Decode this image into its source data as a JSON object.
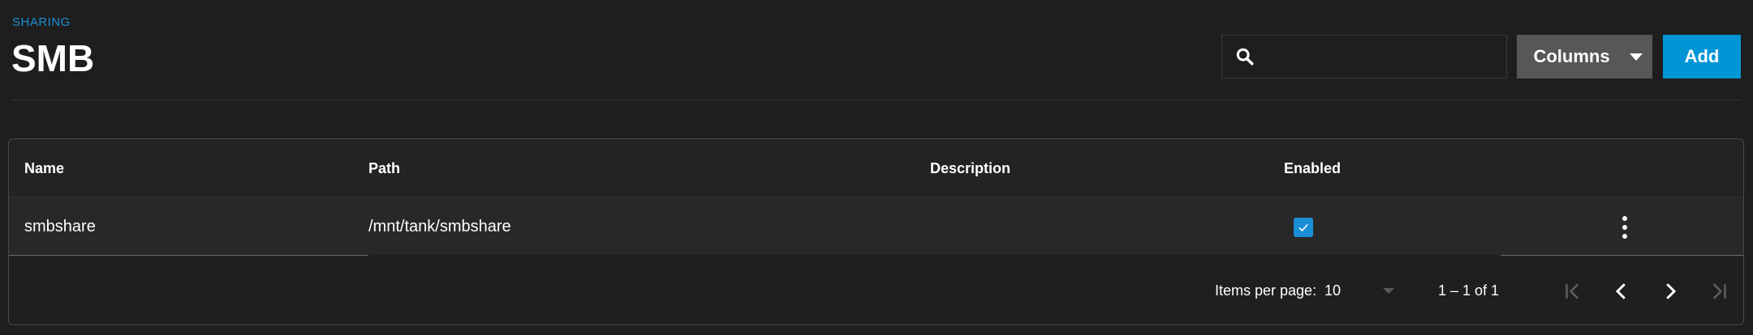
{
  "header": {
    "breadcrumb": "SHARING",
    "title": "SMB",
    "search": {
      "placeholder": "",
      "value": "",
      "icon": "search-icon"
    },
    "columns_button": "Columns",
    "add_button": "Add"
  },
  "table": {
    "columns": [
      "Name",
      "Path",
      "Description",
      "Enabled"
    ],
    "rows": [
      {
        "name": "smbshare",
        "path": "/mnt/tank/smbshare",
        "description": "",
        "enabled": true
      }
    ]
  },
  "paginator": {
    "items_per_page_label": "Items per page:",
    "items_per_page_value": "10",
    "range_label": "1 – 1 of 1"
  },
  "colors": {
    "accent": "#0095d5",
    "breadcrumb": "#1a8fd6",
    "background": "#1e1e1e",
    "columns_button_bg": "#575757"
  }
}
